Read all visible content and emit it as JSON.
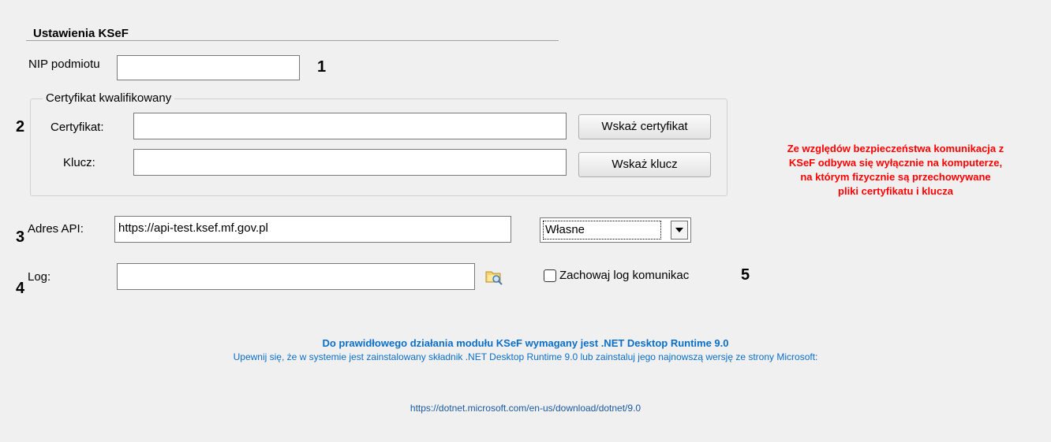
{
  "section": {
    "title": "Ustawienia KSeF"
  },
  "nip": {
    "label": "NIP podmiotu",
    "value": ""
  },
  "markers": {
    "m1": "1",
    "m2": "2",
    "m3": "3",
    "m4": "4",
    "m5": "5"
  },
  "certificate_group": {
    "legend": "Certyfikat kwalifikowany",
    "cert_label": "Certyfikat:",
    "cert_value": "",
    "cert_button": "Wskaż certyfikat",
    "key_label": "Klucz:",
    "key_value": "",
    "key_button": "Wskaż klucz"
  },
  "warning": {
    "line1": "Ze względów bezpieczeństwa komunikacja z",
    "line2": "KSeF odbywa się wyłącznie na komputerze,",
    "line3": "na którym fizycznie są przechowywane",
    "line4": "pliki certyfikatu i klucza",
    "color": "#ff0000"
  },
  "api": {
    "label": "Adres API:",
    "value": "https://api-test.ksef.mf.gov.pl",
    "mode_selected": "Własne"
  },
  "log": {
    "label": "Log:",
    "value": "",
    "browse_icon": "folder-search-icon",
    "keep_log_label": "Zachowaj log komunikac",
    "keep_log_checked": false
  },
  "info": {
    "title": "Do prawidłowego działania modułu KSeF wymagany jest .NET Desktop Runtime 9.0",
    "description": "Upewnij się, że w systemie jest zainstalowany składnik .NET Desktop Runtime 9.0 lub zainstaluj jego najnowszą wersję ze strony Microsoft:",
    "link": "https://dotnet.microsoft.com/en-us/download/dotnet/9.0",
    "color": "#0a6fc9"
  }
}
